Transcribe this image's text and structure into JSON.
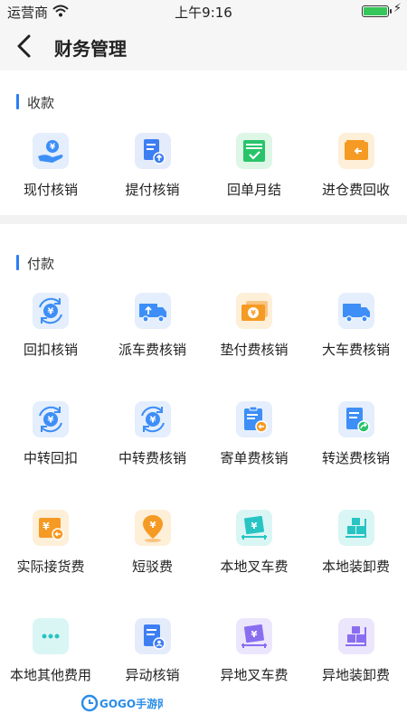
{
  "status_bar": {
    "carrier": "运营商",
    "time": "上午9:16"
  },
  "nav": {
    "title": "财务管理"
  },
  "sections": [
    {
      "title": "收款",
      "items": [
        {
          "label": "现付核销",
          "icon": "cash-hand-icon",
          "color": "#3d8ef7",
          "bg": "#e4eefc"
        },
        {
          "label": "提付核销",
          "icon": "document-upload-icon",
          "color": "#3d7ef3",
          "bg": "#e4ecfb"
        },
        {
          "label": "回单月结",
          "icon": "receipt-check-icon",
          "color": "#28c46a",
          "bg": "#ddf6e6"
        },
        {
          "label": "进仓费回收",
          "icon": "wallet-return-icon",
          "color": "#f59a23",
          "bg": "#fdefd8"
        }
      ]
    },
    {
      "title": "付款",
      "items": [
        {
          "label": "回扣核销",
          "icon": "yen-cycle-icon",
          "color": "#3d8ef7",
          "bg": "#e4eefc"
        },
        {
          "label": "派车费核销",
          "icon": "truck-upload-icon",
          "color": "#3d8ef7",
          "bg": "#e4eefc"
        },
        {
          "label": "垫付费核销",
          "icon": "banknote-icon",
          "color": "#f59a23",
          "bg": "#fdefd8"
        },
        {
          "label": "大车费核销",
          "icon": "truck-icon",
          "color": "#3d8ef7",
          "bg": "#e4eefc"
        },
        {
          "label": "中转回扣",
          "icon": "yen-cycle-icon",
          "color": "#3d8ef7",
          "bg": "#e4eefc"
        },
        {
          "label": "中转费核销",
          "icon": "yen-cycle-icon",
          "color": "#3d8ef7",
          "bg": "#e4eefc"
        },
        {
          "label": "寄单费核销",
          "icon": "clipboard-return-icon",
          "color": "#3d8ef7",
          "bg": "#e4eefc"
        },
        {
          "label": "转送费核销",
          "icon": "document-forward-icon",
          "color": "#3d8ef7",
          "bg": "#e4eefc"
        },
        {
          "label": "实际接货费",
          "icon": "yen-box-return-icon",
          "color": "#f59a23",
          "bg": "#fdefd8"
        },
        {
          "label": "短驳费",
          "icon": "yen-location-icon",
          "color": "#f59a23",
          "bg": "#fdefd8"
        },
        {
          "label": "本地叉车费",
          "icon": "yen-pallet-icon",
          "color": "#28c4c4",
          "bg": "#daf6f4"
        },
        {
          "label": "本地装卸费",
          "icon": "boxes-cart-icon",
          "color": "#28c4c4",
          "bg": "#daf6f4"
        },
        {
          "label": "本地其他费用",
          "icon": "dots-icon",
          "color": "#28c4c4",
          "bg": "#daf6f4"
        },
        {
          "label": "异动核销",
          "icon": "document-user-icon",
          "color": "#3d7ef3",
          "bg": "#e4ecfb"
        },
        {
          "label": "异地叉车费",
          "icon": "yen-pallet-icon",
          "color": "#8a6ef0",
          "bg": "#ece6fd"
        },
        {
          "label": "异地装卸费",
          "icon": "boxes-cart-icon",
          "color": "#8a6ef0",
          "bg": "#ece6fd"
        }
      ]
    }
  ],
  "watermark": {
    "text": "GOGO手游网",
    "color": "#2a8de8"
  }
}
